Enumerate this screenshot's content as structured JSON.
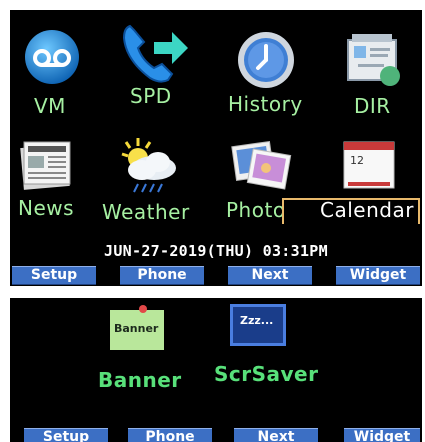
{
  "screen1": {
    "apps": [
      {
        "label": "VM",
        "icon": "voicemail-icon"
      },
      {
        "label": "SPD",
        "icon": "speed-dial-icon"
      },
      {
        "label": "History",
        "icon": "history-clock-icon"
      },
      {
        "label": "DIR",
        "icon": "directory-icon"
      },
      {
        "label": "News",
        "icon": "news-icon"
      },
      {
        "label": "Weather",
        "icon": "weather-icon"
      },
      {
        "label": "Photo",
        "icon": "photo-icon"
      },
      {
        "label": "Calendar",
        "icon": "calendar-icon"
      }
    ],
    "calendar_icon_day": "12",
    "datetime": "JUN-27-2019(THU) 03:31PM",
    "softkeys": [
      "Setup",
      "Phone",
      "Next",
      "Widget"
    ]
  },
  "screen2": {
    "apps": [
      {
        "label": "Banner",
        "icon_text": "Banner",
        "icon": "banner-note-icon"
      },
      {
        "label": "ScrSaver",
        "icon_text": "Zzz...",
        "icon": "screensaver-icon"
      }
    ],
    "softkeys": [
      "Setup",
      "Phone",
      "Next",
      "Widget"
    ]
  },
  "colors": {
    "label_green": "#a6f0a2",
    "softkey_blue": "#3c6fc4",
    "highlight_orange": "#e9b96b"
  }
}
